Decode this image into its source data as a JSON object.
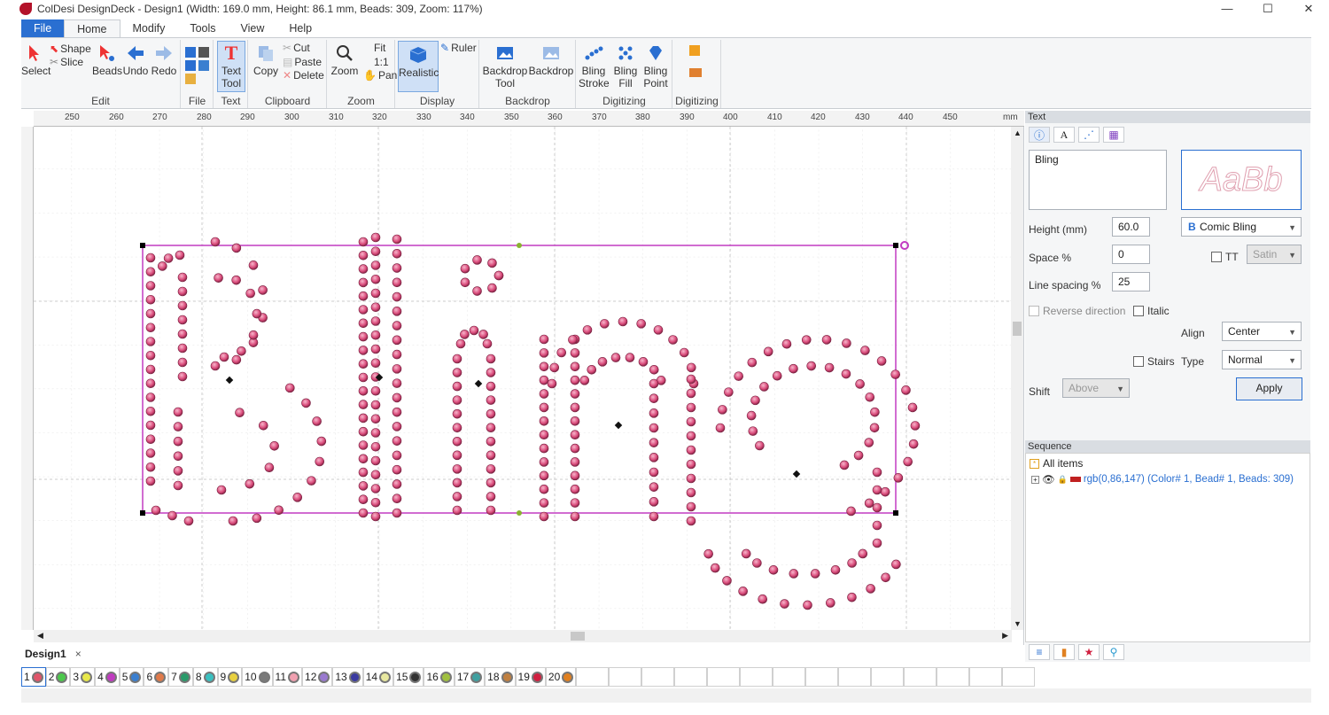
{
  "window": {
    "title": "ColDesi DesignDeck - Design1 (Width: 169.0 mm, Height: 86.1 mm, Beads: 309, Zoom: 117%)",
    "controls": [
      "—",
      "☐",
      "✕"
    ]
  },
  "menu": {
    "tabs": [
      "File",
      "Home",
      "Modify",
      "Tools",
      "View",
      "Help"
    ],
    "active": "Home"
  },
  "ribbon": {
    "edit": {
      "label": "Edit",
      "select": "Select",
      "shape": "Shape",
      "slice": "Slice",
      "beads": "Beads",
      "undo": "Undo",
      "redo": "Redo"
    },
    "file": {
      "label": "File"
    },
    "text": {
      "label": "Text",
      "text_tool_l1": "Text",
      "text_tool_l2": "Tool"
    },
    "clipboard": {
      "label": "Clipboard",
      "copy": "Copy",
      "cut": "Cut",
      "paste": "Paste",
      "delete": "Delete"
    },
    "zoom": {
      "label": "Zoom",
      "zoom": "Zoom",
      "fit": "Fit",
      "one_to_one": "1:1",
      "pan": "Pan"
    },
    "display": {
      "label": "Display",
      "realistic": "Realistic",
      "ruler": "Ruler"
    },
    "backdrop": {
      "label": "Backdrop",
      "tool_l1": "Backdrop",
      "tool_l2": "Tool",
      "backdrop": "Backdrop"
    },
    "digitizing": {
      "label": "Digitizing",
      "stroke_l1": "Bling",
      "stroke_l2": "Stroke",
      "fill_l1": "Bling",
      "fill_l2": "Fill",
      "point_l1": "Bling",
      "point_l2": "Point"
    },
    "digitizing2": {
      "label": "Digitizing"
    }
  },
  "ruler": {
    "ticks": [
      "250",
      "260",
      "270",
      "280",
      "290",
      "300",
      "310",
      "320",
      "330",
      "340",
      "350",
      "360",
      "370",
      "380",
      "390",
      "400",
      "410",
      "420",
      "430",
      "440",
      "450"
    ],
    "unit": "mm"
  },
  "design": {
    "text": "Bling",
    "bead_color": "#d94a7a",
    "frame_color": "#c23bc2"
  },
  "text_panel": {
    "header": "Text",
    "text_value": "Bling",
    "preview": "AaBb",
    "height_label": "Height (mm)",
    "height_value": "60.0",
    "font_name": "Comic Bling",
    "space_label": "Space %",
    "space_value": "0",
    "tt_label": "TT",
    "satin_label": "Satin",
    "line_spacing_label": "Line spacing %",
    "line_spacing_value": "25",
    "reverse_label": "Reverse direction",
    "italic_label": "Italic",
    "align_label": "Align",
    "align_value": "Center",
    "stairs_label": "Stairs",
    "type_label": "Type",
    "type_value": "Normal",
    "shift_label": "Shift",
    "shift_value": "Above",
    "apply_label": "Apply"
  },
  "sequence": {
    "header": "Sequence",
    "all_items": "All items",
    "item": "rgb(0,86,147) (Color# 1, Bead# 1, Beads: 309)"
  },
  "doc_tabs": {
    "name": "Design1",
    "close": "×"
  },
  "color_slots": [
    {
      "num": "1",
      "color": "#e0566a"
    },
    {
      "num": "2",
      "color": "#4cc84c"
    },
    {
      "num": "3",
      "color": "#e8e84a"
    },
    {
      "num": "4",
      "color": "#c03cc0"
    },
    {
      "num": "5",
      "color": "#3a7fd0"
    },
    {
      "num": "6",
      "color": "#e07a4a"
    },
    {
      "num": "7",
      "color": "#2a9a6a"
    },
    {
      "num": "8",
      "color": "#3ac0c0"
    },
    {
      "num": "9",
      "color": "#e8d040"
    },
    {
      "num": "10",
      "color": "#7a7a7a"
    },
    {
      "num": "11",
      "color": "#f0a0b0"
    },
    {
      "num": "12",
      "color": "#9a7ad0"
    },
    {
      "num": "13",
      "color": "#3a3aa0"
    },
    {
      "num": "14",
      "color": "#e8e8a0"
    },
    {
      "num": "15",
      "color": "#333333"
    },
    {
      "num": "16",
      "color": "#a0c040"
    },
    {
      "num": "17",
      "color": "#40a0a0"
    },
    {
      "num": "18",
      "color": "#c08040"
    },
    {
      "num": "19",
      "color": "#d02040"
    },
    {
      "num": "20",
      "color": "#e08020"
    }
  ]
}
